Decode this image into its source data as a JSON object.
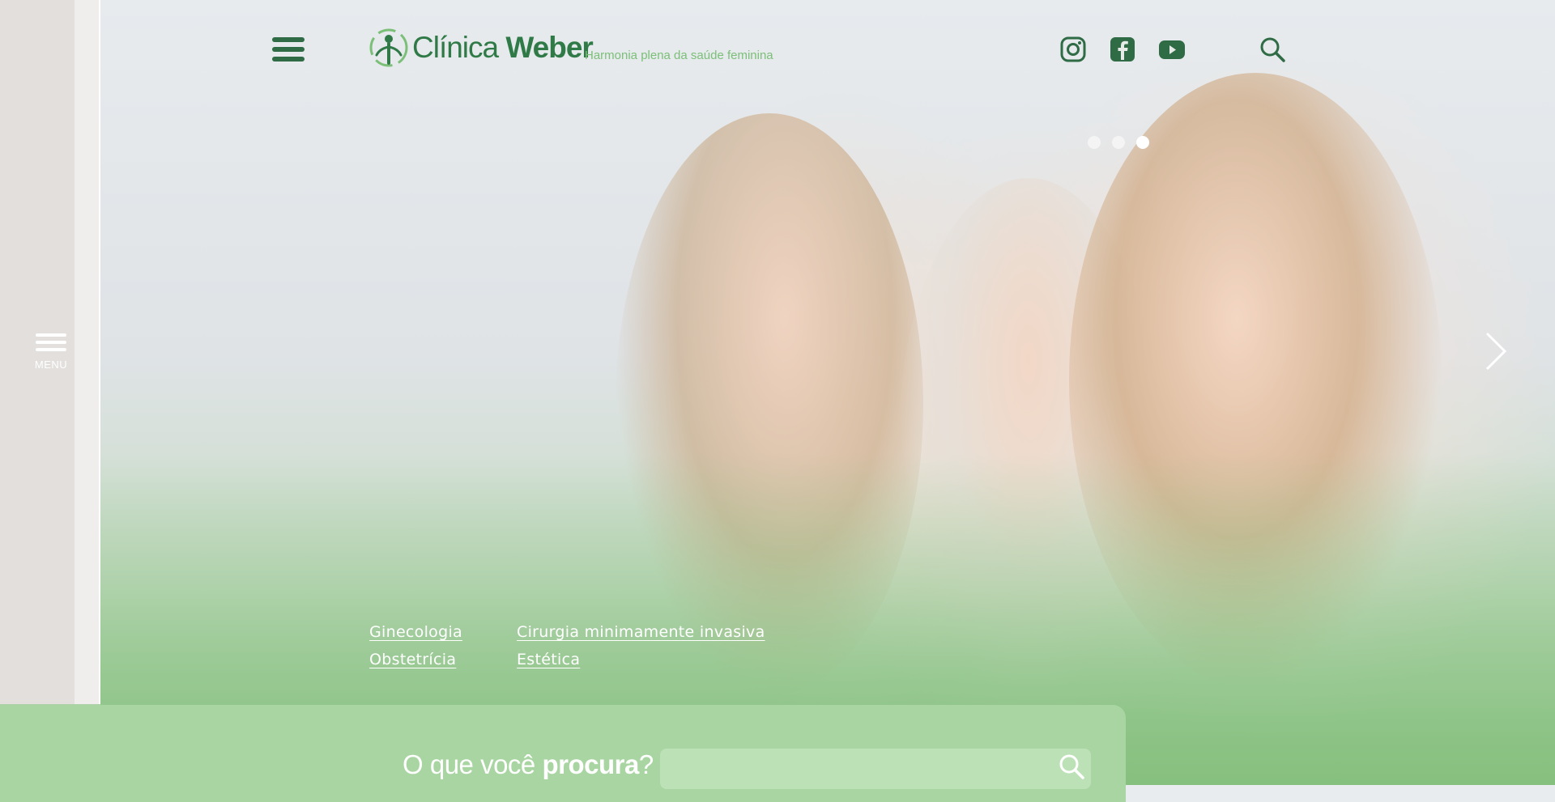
{
  "colors": {
    "brand_green": "#2f7a46",
    "dark_green": "#2f6b45",
    "light_green": "#a8d5a1",
    "tagline_green": "#7cbf78"
  },
  "side_menu": {
    "icon": "hamburger-icon",
    "label": "MENU"
  },
  "header": {
    "menu_icon": "hamburger-icon",
    "logo": {
      "icon": "clinic-logo-mark",
      "name_light": "Clínica",
      "name_bold": "Weber"
    },
    "tagline": "Harmonia plena da saúde feminina",
    "social": [
      {
        "name": "instagram",
        "icon": "instagram-icon"
      },
      {
        "name": "facebook",
        "icon": "facebook-icon"
      },
      {
        "name": "youtube",
        "icon": "youtube-icon"
      }
    ],
    "search_icon": "search-icon"
  },
  "slider": {
    "slide_count": 3,
    "active_slide": 3,
    "next_icon": "chevron-right-icon"
  },
  "quick_links": {
    "col1": [
      "Ginecologia",
      "Obstetrícia"
    ],
    "col2": [
      "Cirurgia minimamente invasiva",
      "Estética"
    ]
  },
  "search": {
    "label_prefix": "O que você ",
    "label_strong": "procura",
    "label_suffix": "?",
    "placeholder": "",
    "button_icon": "search-icon"
  }
}
